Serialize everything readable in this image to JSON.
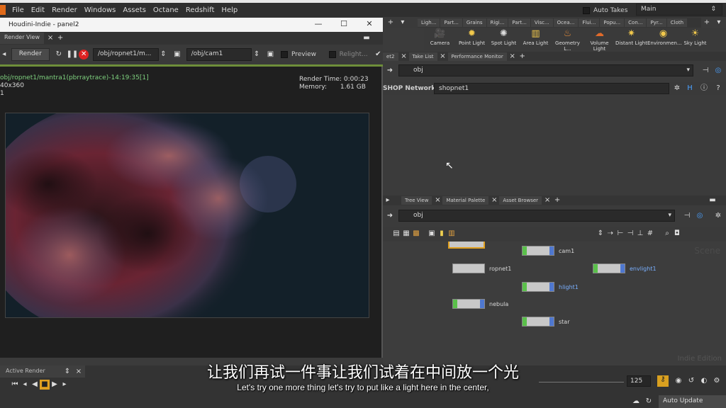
{
  "menubar": {
    "items": [
      "File",
      "Edit",
      "Render",
      "Windows",
      "Assets",
      "Octane",
      "Redshift",
      "Help"
    ],
    "auto_takes": "Auto Takes",
    "desktop": "Main"
  },
  "window": {
    "title": "Houdini-Indie - panel2",
    "tab": "Render View",
    "toolbar": {
      "render": "Render",
      "rop_path": "/obj/ropnet1/m...",
      "cam_path": "/obj/cam1",
      "preview": "Preview",
      "relight": "Relight..."
    },
    "info": {
      "path": "obj/ropnet1/mantra1(pbrraytrace)-14:19:35[1]",
      "res": "40x360",
      "frame": "1",
      "render_time_label": "Render Time:",
      "render_time": "0:00:23",
      "memory_label": "Memory:",
      "memory": "1.61 GB"
    }
  },
  "shelf": {
    "tabs": [
      "Ligh...",
      "Part...",
      "Grains",
      "Rigi...",
      "Part...",
      "Visc...",
      "Ocea...",
      "Flui...",
      "Popu...",
      "Con...",
      "Pyr...",
      "Cloth"
    ],
    "tools": [
      "Camera",
      "Point Light",
      "Spot Light",
      "Area Light",
      "Geometry L...",
      "Volume Light",
      "Distant Light",
      "Environmen...",
      "Sky Light"
    ]
  },
  "pane1": {
    "tabs": [
      "et2",
      "Take List",
      "Performance Monitor"
    ],
    "path": "obj",
    "shop_label": "SHOP Network",
    "shop_value": "shopnet1"
  },
  "pane2": {
    "tabs": [
      "Tree View",
      "Material Palette",
      "Asset Browser"
    ],
    "path": "obj",
    "watermark": "Scene",
    "edition": "Indie Edition",
    "nodes": [
      "cam1",
      "ropnet1",
      "envlight1",
      "hlight1",
      "nebula",
      "star"
    ]
  },
  "bottom": {
    "active_render": "Active Render",
    "frame": "125",
    "auto_update": "Auto Update"
  },
  "subtitles": {
    "zh": "让我们再试一件事让我们试着在中间放一个光",
    "en": "Let's try one more thing let's try to put like a light here in the center,"
  }
}
